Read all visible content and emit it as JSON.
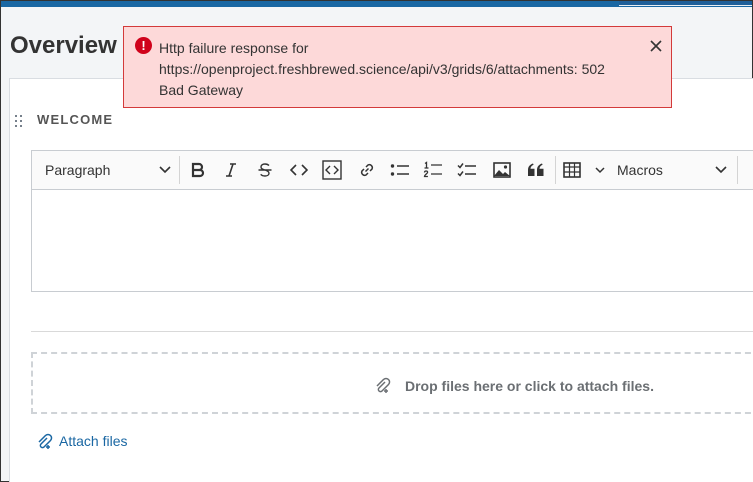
{
  "page": {
    "title": "Overview"
  },
  "widget": {
    "title": "WELCOME"
  },
  "editor": {
    "paragraph_label": "Paragraph",
    "macros_label": "Macros",
    "tools": [
      "bold-icon",
      "italic-icon",
      "strikethrough-icon",
      "inline-code-icon",
      "code-block-icon",
      "link-icon",
      "bulleted-list-icon",
      "numbered-list-icon",
      "todo-list-icon",
      "image-icon",
      "blockquote-icon",
      "table-icon"
    ]
  },
  "dropzone": {
    "text": "Drop files here or click to attach files."
  },
  "attach": {
    "label": "Attach files"
  },
  "toast": {
    "line1": "Http failure response for",
    "line2": "https://openproject.freshbrewed.science/api/v3/grids/6/attachments: 502",
    "line3": "Bad Gateway"
  },
  "colors": {
    "accent": "#1a67a3",
    "error": "#d0021b",
    "toast_bg": "#fdd9d9"
  }
}
